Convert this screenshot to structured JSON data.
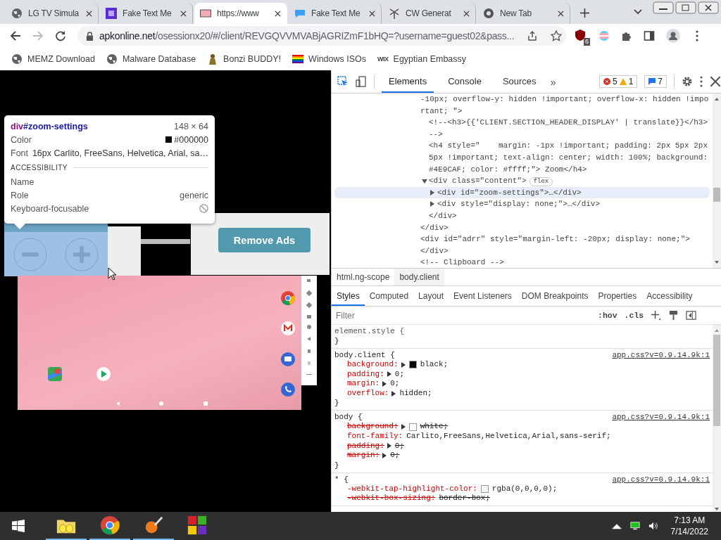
{
  "browser_tabs": [
    {
      "title": "LG TV Simula",
      "kind": "globe",
      "selected": false
    },
    {
      "title": "Fake Text Me",
      "kind": "square",
      "selected": false
    },
    {
      "title": "https://www",
      "kind": "rect",
      "selected": true
    },
    {
      "title": "Fake Text Me",
      "kind": "bubble",
      "selected": false
    },
    {
      "title": "CW Generat",
      "kind": "windmill",
      "selected": false
    },
    {
      "title": "New Tab",
      "kind": "chrome",
      "selected": false
    }
  ],
  "address_bar": {
    "host": "apkonline.net",
    "path": "/osessionx20/#/client/REVGQVVMVABjAGRIZmF1bHQ=?username=guest02&pass..."
  },
  "extension_badge": "6",
  "bookmarks": [
    {
      "label": "MEMZ Download",
      "kind": "globe"
    },
    {
      "label": "Malware Database",
      "kind": "globe"
    },
    {
      "label": "Bonzi BUDDY!",
      "kind": "figure"
    },
    {
      "label": "Windows ISOs",
      "kind": "flag"
    },
    {
      "label": "Egyptian Embassy",
      "kind": "logo",
      "logo_text": "WIX"
    }
  ],
  "inspect_tooltip": {
    "tag": "div",
    "id": "#zoom-settings",
    "size": "148 × 64",
    "rows": [
      {
        "label": "Color",
        "value": "#000000",
        "color": "#000000"
      },
      {
        "label": "Font",
        "value": "16px Carlito, FreeSans, Helvetica, Arial, sa…"
      }
    ],
    "section": "ACCESSIBILITY",
    "accessibility": [
      {
        "label": "Name",
        "kind": "text"
      },
      {
        "label": "Role",
        "kind": "text",
        "value": "generic"
      },
      {
        "label": "Keyboard-focusable",
        "kind": "flag",
        "focusable": false
      }
    ]
  },
  "remove_ads_button": "Remove Ads",
  "devtools": {
    "tabs": [
      {
        "label": "Elements",
        "selected": true
      },
      {
        "label": "Console",
        "selected": false
      },
      {
        "label": "Sources",
        "selected": false
      }
    ],
    "more_tabs": "»",
    "errors": "5",
    "warnings": "1",
    "messages": "7",
    "dom_tree": [
      {
        "lines": [
          "-10px; overflow-y: hidden !important; overflow-x: hidden !impo",
          "rtant; \">"
        ],
        "selected": false,
        "children": [
          {
            "lines": [
              "<!--<h3>{{'CLIENT.SECTION_HEADER_DISPLAY' | translate}}</h3>",
              "-->"
            ],
            "selected": false
          },
          {
            "lines": [
              "<h4 style=\"    margin: -1px !important; padding: 2px 5px 2px",
              "5px !important; text-align: center; width: 100%; background:",
              "#4E9CAF; color: #ffff;\"> Zoom</h4>"
            ],
            "selected": false
          },
          {
            "lines": [
              "<div class=\"content\">"
            ],
            "badge": "flex",
            "expanded": true,
            "selected": false,
            "children": [
              {
                "lines": [
                  "<div id=\"zoom-settings\">…</div>"
                ],
                "expanded": false,
                "selected": true
              },
              {
                "lines": [
                  "<div style=\"display: none;\">…</div>"
                ],
                "expanded": false,
                "selected": false
              }
            ]
          },
          {
            "lines": [
              "</div>"
            ],
            "selected": false
          }
        ]
      },
      {
        "lines": [
          "</div>"
        ],
        "selected": false
      },
      {
        "lines": [
          "<div id=\"adrr\" style=\"margin-left: -20px; display: none;\">"
        ],
        "selected": false
      },
      {
        "lines": [
          "</div>"
        ],
        "selected": false
      },
      {
        "lines": [
          "<!-- Clipboard -->"
        ],
        "selected": false
      }
    ],
    "breadcrumbs": [
      {
        "label": "html.ng-scope",
        "selected": false
      },
      {
        "label": "body.client",
        "selected": true
      }
    ],
    "pane_tabs": [
      {
        "label": "Styles",
        "selected": true
      },
      {
        "label": "Computed",
        "selected": false
      },
      {
        "label": "Layout",
        "selected": false
      },
      {
        "label": "Event Listeners",
        "selected": false
      },
      {
        "label": "DOM Breakpoints",
        "selected": false
      },
      {
        "label": "Properties",
        "selected": false
      },
      {
        "label": "Accessibility",
        "selected": false
      }
    ],
    "filter": {
      "placeholder": "Filter"
    },
    "hov": ":hov",
    "cls": ".cls",
    "rules": [
      {
        "selector": "element.style {",
        "close": "}"
      },
      {
        "selector": "body.client {",
        "source": "app.css?v=0.9.14.9k:1",
        "close": "}",
        "declarations": [
          {
            "property": "background:",
            "value": "black;",
            "expandable": true,
            "color": "#000000",
            "struck": false
          },
          {
            "property": "padding:",
            "value": "0;",
            "expandable": true,
            "struck": false
          },
          {
            "property": "margin:",
            "value": "0;",
            "expandable": true,
            "struck": false
          },
          {
            "property": "overflow:",
            "value": "hidden;",
            "expandable": true,
            "struck": false
          }
        ]
      },
      {
        "selector": "body {",
        "source": "app.css?v=0.9.14.9k:1",
        "close": "}",
        "declarations": [
          {
            "property": "background:",
            "value": "white;",
            "expandable": true,
            "color": "#ffffff",
            "struck": true
          },
          {
            "property": "font-family:",
            "value": "Carlito,FreeSans,Helvetica,Arial,sans-serif;",
            "expandable": false,
            "struck": false
          },
          {
            "property": "padding:",
            "value": "0;",
            "expandable": true,
            "struck": true
          },
          {
            "property": "margin:",
            "value": "0;",
            "expandable": true,
            "struck": true
          }
        ]
      },
      {
        "selector": "* {",
        "source": "app.css?v=0.9.14.9k:1",
        "declarations": [
          {
            "property": "-webkit-tap-highlight-color:",
            "value": "rgba(0,0,0,0);",
            "expandable": false,
            "color": "#f4f4f4",
            "struck": false
          },
          {
            "property": "-webkit-box-sizing:",
            "value": "border-box;",
            "expandable": false,
            "struck": true
          }
        ]
      }
    ]
  },
  "taskbar": {
    "apps": [
      {
        "kind": "folder",
        "running": true
      },
      {
        "kind": "chrome",
        "running": true
      },
      {
        "kind": "paint",
        "running": true
      },
      {
        "kind": "squares",
        "running": false
      }
    ],
    "time": "7:13 AM",
    "date": "7/14/2022"
  }
}
